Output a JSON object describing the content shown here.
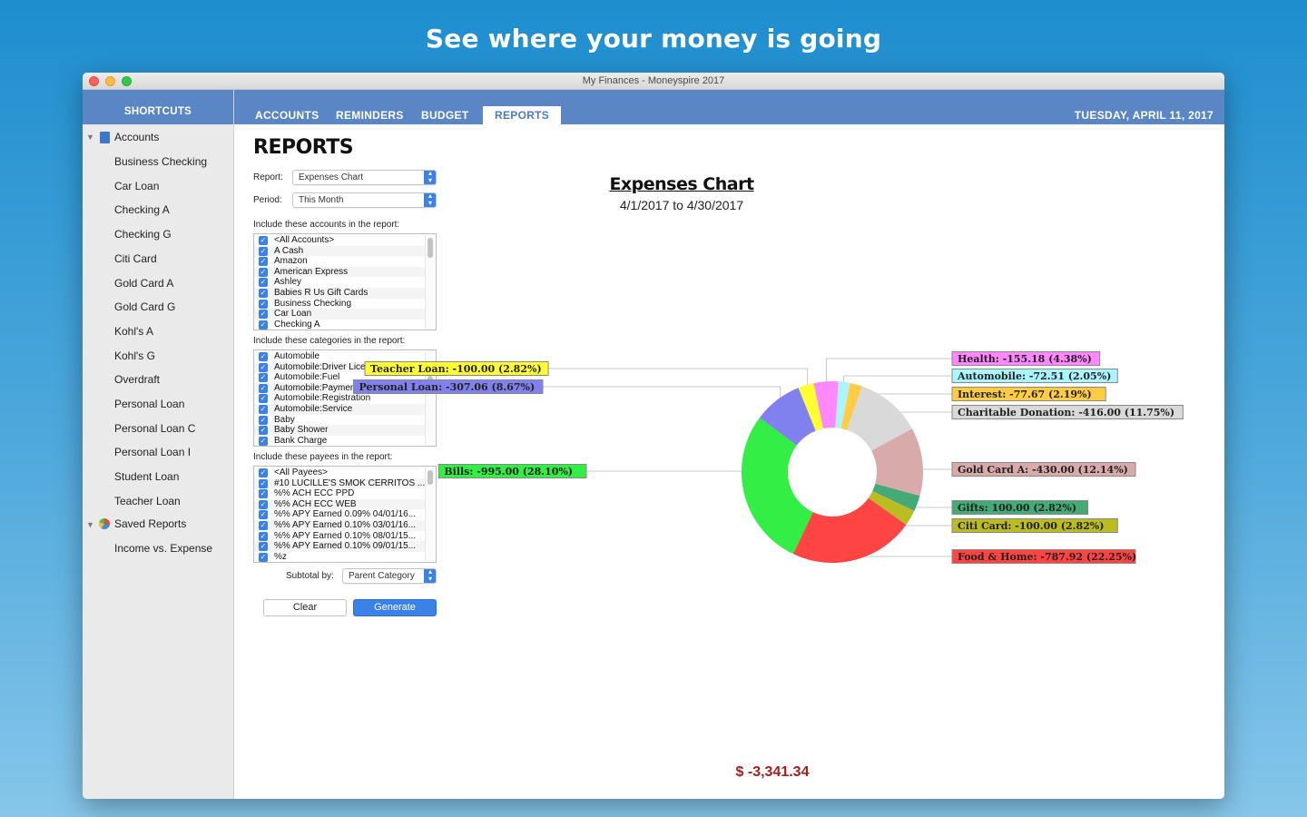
{
  "headline": "See where your money is going",
  "window": {
    "title": "My Finances - Moneyspire 2017"
  },
  "sidebar": {
    "header": "SHORTCUTS",
    "accounts_label": "Accounts",
    "accounts": [
      "Business Checking",
      "Car Loan",
      "Checking A",
      "Checking G",
      "Citi Card",
      "Gold Card A",
      "Gold Card G",
      "Kohl's A",
      "Kohl's G",
      "Overdraft",
      "Personal Loan",
      "Personal Loan C",
      "Personal Loan I",
      "Student Loan",
      "Teacher Loan"
    ],
    "saved_reports_label": "Saved Reports",
    "saved_reports": [
      "Income vs. Expense"
    ]
  },
  "tabs": [
    "ACCOUNTS",
    "REMINDERS",
    "BUDGET",
    "REPORTS"
  ],
  "active_tab": "REPORTS",
  "date": "TUESDAY, APRIL 11, 2017",
  "reports": {
    "title": "REPORTS",
    "report_label": "Report:",
    "report_value": "Expenses Chart",
    "period_label": "Period:",
    "period_value": "This Month",
    "accounts_label": "Include these accounts in the report:",
    "accounts_list": [
      "<All Accounts>",
      "A Cash",
      "Amazon",
      "American Express",
      "Ashley",
      "Babies R Us Gift Cards",
      "Business Checking",
      "Car Loan",
      "Checking A"
    ],
    "categories_label": "Include these categories in the report:",
    "categories_list": [
      "Automobile",
      "Automobile:Driver License",
      "Automobile:Fuel",
      "Automobile:Payment",
      "Automobile:Registration",
      "Automobile:Service",
      "Baby",
      "Baby Shower",
      "Bank Charge"
    ],
    "payees_label": "Include these payees in the report:",
    "payees_list": [
      "<All Payees>",
      "#10 LUCILLE'S SMOK CERRITOS ...",
      "%% ACH ECC PPD",
      "%% ACH ECC WEB",
      "%% APY Earned 0.09% 04/01/16...",
      "%% APY Earned 0.10% 03/01/16...",
      "%% APY Earned 0.10% 08/01/15...",
      "%% APY Earned 0.10% 09/01/15...",
      "%z"
    ],
    "subtotal_label": "Subtotal by:",
    "subtotal_value": "Parent Category",
    "clear_label": "Clear",
    "generate_label": "Generate"
  },
  "chart_data": {
    "type": "pie",
    "title": "Expenses Chart",
    "subtitle": "4/1/2017 to 4/30/2017",
    "total": "$ -3,341.34",
    "slices": [
      {
        "name": "Teacher Loan",
        "value": -100.0,
        "label": "Teacher Loan: -100.00 (2.82%)",
        "percent": 2.82,
        "color": "#ffff33"
      },
      {
        "name": "Health",
        "value": -155.18,
        "label": "Health: -155.18 (4.38%)",
        "percent": 4.38,
        "color": "#ff88ff"
      },
      {
        "name": "Automobile",
        "value": -72.51,
        "label": "Automobile: -72.51 (2.05%)",
        "percent": 2.05,
        "color": "#aaf5ff"
      },
      {
        "name": "Interest",
        "value": -77.67,
        "label": "Interest: -77.67 (2.19%)",
        "percent": 2.19,
        "color": "#ffcc44"
      },
      {
        "name": "Charitable Donation",
        "value": -416.0,
        "label": "Charitable Donation: -416.00 (11.75%)",
        "percent": 11.75,
        "color": "#d9d9d9"
      },
      {
        "name": "Gold Card A",
        "value": -430.0,
        "label": "Gold Card A: -430.00 (12.14%)",
        "percent": 12.14,
        "color": "#d9aaaa"
      },
      {
        "name": "Gifts",
        "value": 100.0,
        "label": "Gifts: 100.00 (2.82%)",
        "percent": 2.82,
        "color": "#44aa77"
      },
      {
        "name": "Citi Card",
        "value": -100.0,
        "label": "Citi Card: -100.00 (2.82%)",
        "percent": 2.82,
        "color": "#bbbb22"
      },
      {
        "name": "Food & Home",
        "value": -787.92,
        "label": "Food & Home: -787.92 (22.25%)",
        "percent": 22.25,
        "color": "#ff4444"
      },
      {
        "name": "Bills",
        "value": -995.0,
        "label": "Bills: -995.00 (28.10%)",
        "percent": 28.1,
        "color": "#33ee44"
      },
      {
        "name": "Personal Loan",
        "value": -307.06,
        "label": "Personal Loan: -307.06 (8.67%)",
        "percent": 8.67,
        "color": "#8080ee"
      }
    ]
  }
}
